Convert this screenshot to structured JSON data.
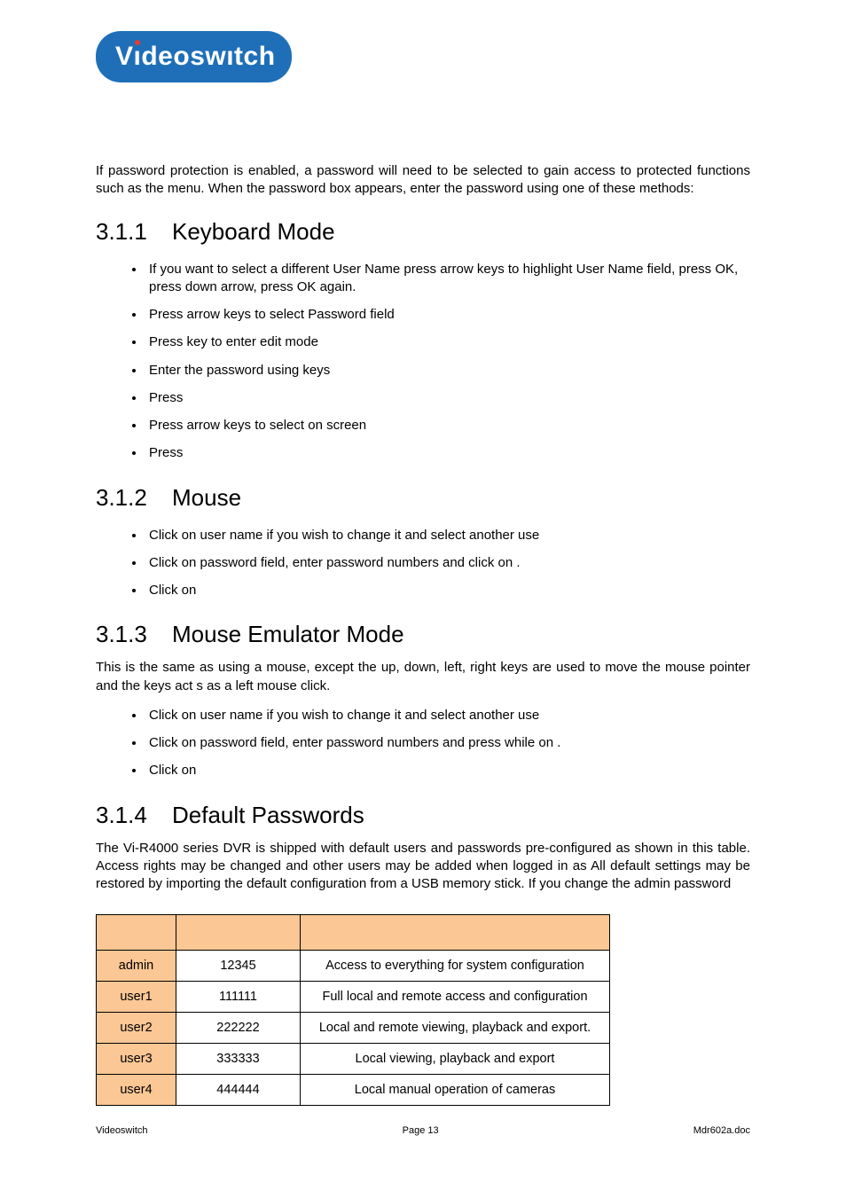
{
  "logo_text_pre": "V",
  "logo_text_mid": "ı",
  "logo_text_rest": "deoswıtch",
  "intro": "If password protection is enabled, a password will need to be selected to gain access to protected functions such as the menu. When the password box appears, enter the password using one of these methods:",
  "s1": {
    "num": "3.1.1",
    "title": "Keyboard Mode"
  },
  "s1_items": [
    "If you want to select a different User Name press arrow keys to highlight User Name field, press OK, press down arrow, press OK again.",
    "Press arrow keys to select Password field",
    "Press        key to enter edit mode",
    "Enter the password  using      keys",
    "Press",
    "Press arrow keys to select       on screen",
    "Press"
  ],
  "s2": {
    "num": "3.1.2",
    "title": "Mouse"
  },
  "s2_items": [
    "Click on user name if you wish to change it and select another use",
    "Click on password field, enter password numbers and click on            .",
    "Click on"
  ],
  "s3": {
    "num": "3.1.3",
    "title": "Mouse Emulator Mode"
  },
  "s3_para": "This is the same as using a mouse, except the up, down, left, right keys are used to move the mouse pointer and the       keys act s as a left mouse click.",
  "s3_items": [
    "Click on user name if you wish to change it and select another use",
    "Click on password field, enter password numbers and press        while on            .",
    "Click on"
  ],
  "s4": {
    "num": "3.1.4",
    "title": "Default Passwords"
  },
  "s4_para": "The Vi-R4000 series DVR is shipped with default users and passwords pre-configured as shown in this table. Access rights may be changed and other users may be added when logged in as            All default settings may be restored by importing the default configuration from a USB memory stick. If you change the admin password",
  "table": {
    "headers": [
      "",
      "",
      ""
    ],
    "rows": [
      {
        "user": "admin",
        "pw": "12345",
        "rights": "Access to everything for system configuration"
      },
      {
        "user": "user1",
        "pw": "111111",
        "rights": "Full local and remote access and configuration"
      },
      {
        "user": "user2",
        "pw": "222222",
        "rights": "Local and remote viewing, playback and export."
      },
      {
        "user": "user3",
        "pw": "333333",
        "rights": "Local viewing, playback and export"
      },
      {
        "user": "user4",
        "pw": "444444",
        "rights": "Local manual operation of cameras"
      }
    ]
  },
  "footer": {
    "left": "Videoswitch",
    "center": "Page 13",
    "right": "Mdr602a.doc"
  }
}
